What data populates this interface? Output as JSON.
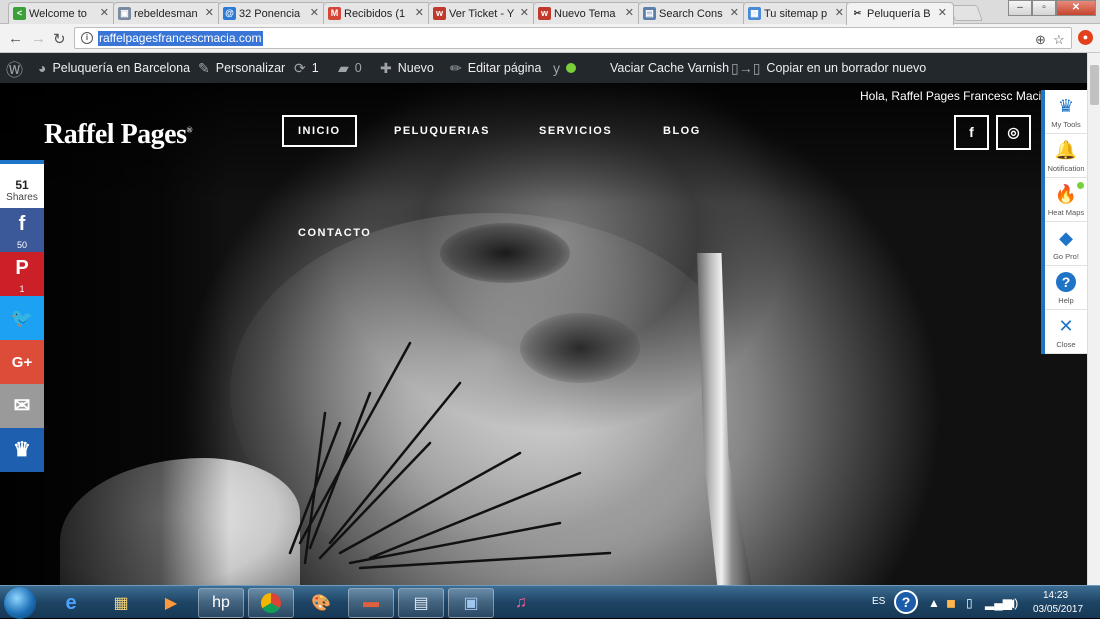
{
  "browser": {
    "tabs": [
      {
        "label": "Welcome to",
        "favicon_color": "#3aa03a",
        "favicon": "<"
      },
      {
        "label": "rebeldesman",
        "favicon_color": "#7a8aa0",
        "favicon": "▣"
      },
      {
        "label": "32 Ponencia",
        "favicon_color": "#2e7bd6",
        "favicon": "@"
      },
      {
        "label": "Recibidos (1",
        "favicon_color": "#d44638",
        "favicon": "M"
      },
      {
        "label": "Ver Ticket - Y",
        "favicon_color": "#c0392b",
        "favicon": "w"
      },
      {
        "label": "Nuevo Tema",
        "favicon_color": "#c0392b",
        "favicon": "w"
      },
      {
        "label": "Search Cons",
        "favicon_color": "#5d7fae",
        "favicon": "▤"
      },
      {
        "label": "Tu sitemap p",
        "favicon_color": "#4a8bd6",
        "favicon": "▦"
      },
      {
        "label": "Peluquería B",
        "favicon_color": "#333333",
        "favicon": "✂"
      }
    ],
    "url": "raffelpagesfrancescmacia.com"
  },
  "adminbar": {
    "site_name": "Peluquería en Barcelona",
    "customize": "Personalizar",
    "updates": "1",
    "comments": "0",
    "new": "Nuevo",
    "edit": "Editar página",
    "varnish": "Vaciar Cache Varnish",
    "copy_draft": "Copiar en un borrador nuevo"
  },
  "site": {
    "greeting": "Hola, Raffel Pages Francesc Macia",
    "logo": "Raffel Pages",
    "menu": [
      "INICIO",
      "PELUQUERIAS",
      "SERVICIOS",
      "BLOG",
      "CONTACTO"
    ],
    "social": {
      "facebook": "f",
      "instagram": "◎"
    }
  },
  "sharebar": {
    "total": "51",
    "total_label": "Shares",
    "buttons": [
      {
        "name": "facebook",
        "glyph": "f",
        "count": "50",
        "color": "#3b5998"
      },
      {
        "name": "pinterest",
        "glyph": "P",
        "count": "1",
        "color": "#cb2027"
      },
      {
        "name": "twitter",
        "glyph": "🐦",
        "count": "",
        "color": "#1da1f2"
      },
      {
        "name": "googleplus",
        "glyph": "G+",
        "count": "",
        "color": "#dd4b39"
      },
      {
        "name": "email",
        "glyph": "✉",
        "count": "",
        "color": "#9a9a9a"
      },
      {
        "name": "sumo",
        "glyph": "♛",
        "count": "",
        "color": "#1e5fb0"
      }
    ]
  },
  "toolpanel": [
    {
      "label": "My Tools",
      "glyph": "♛"
    },
    {
      "label": "Notification",
      "glyph": "🔔"
    },
    {
      "label": "Heat Maps",
      "glyph": "🔥"
    },
    {
      "label": "Go Pro!",
      "glyph": "◆"
    },
    {
      "label": "Help",
      "glyph": "?"
    },
    {
      "label": "Close",
      "glyph": "✕"
    }
  ],
  "taskbar": {
    "lang": "ES",
    "time": "14:23",
    "date": "03/05/2017"
  }
}
